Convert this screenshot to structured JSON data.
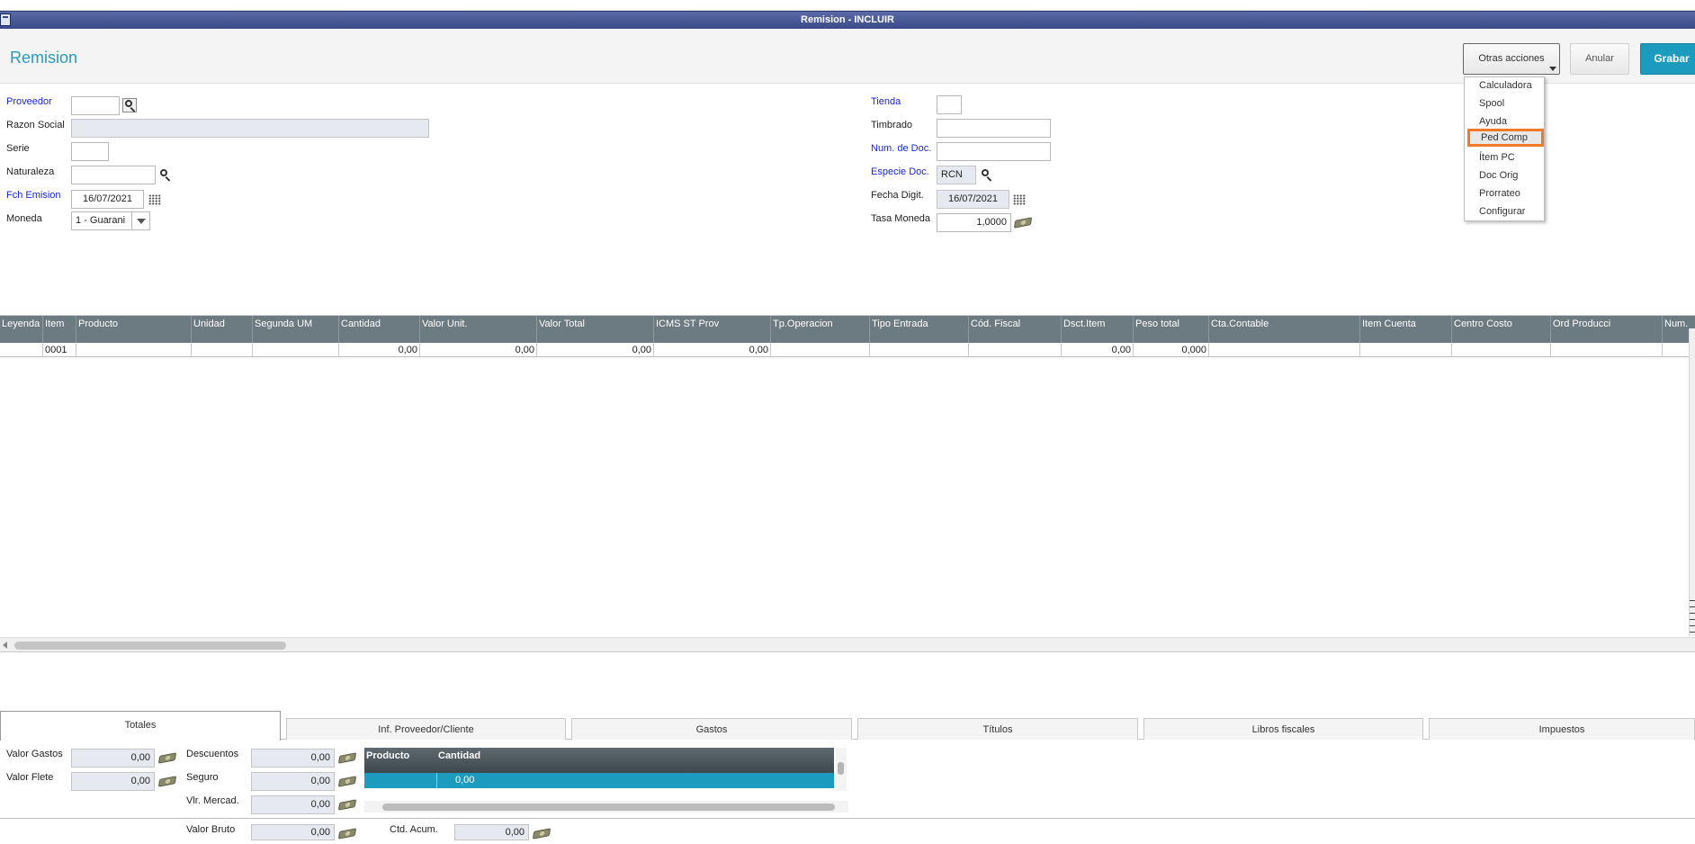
{
  "window": {
    "title": "Remision - INCLUIR"
  },
  "header": {
    "page_title": "Remision",
    "otras_acciones": "Otras acciones",
    "anular": "Anular",
    "grabar": "Grabar"
  },
  "menu": {
    "items": [
      "Calculadora",
      "Spool",
      "Ayuda",
      "Ped Comp",
      "Ítem PC",
      "Doc Orig",
      "Prorrateo",
      "Configurar"
    ],
    "selected": "Ped Comp"
  },
  "form_left": {
    "proveedor_label": "Proveedor",
    "proveedor_value": "",
    "razon_social_label": "Razon Social",
    "razon_social_value": "",
    "serie_label": "Serie",
    "serie_value": "",
    "naturaleza_label": "Naturaleza",
    "naturaleza_value": "",
    "fch_emision_label": "Fch Emision",
    "fch_emision_value": "16/07/2021",
    "moneda_label": "Moneda",
    "moneda_value": "1 - Guarani"
  },
  "form_right": {
    "tienda_label": "Tienda",
    "tienda_value": "",
    "timbrado_label": "Timbrado",
    "timbrado_value": "",
    "num_doc_label": "Num. de Doc.",
    "num_doc_value": "",
    "especie_label": "Especie Doc.",
    "especie_value": "RCN",
    "fecha_digit_label": "Fecha Digit.",
    "fecha_digit_value": "16/07/2021",
    "tasa_label": "Tasa Moneda",
    "tasa_value": "1,0000"
  },
  "grid": {
    "columns": [
      "Leyenda",
      "Item",
      "Producto",
      "Unidad",
      "Segunda UM",
      "Cantidad",
      "Valor Unit.",
      "Valor Total",
      "ICMS ST Prov",
      "Tp.Operacion",
      "Tipo Entrada",
      "Cód. Fiscal",
      "Dsct.Item",
      "Peso total",
      "Cta.Contable",
      "Item Cuenta",
      "Centro Costo",
      "Ord Producci",
      "Num."
    ],
    "rows": [
      [
        "",
        "0001",
        "",
        "",
        "",
        "0,00",
        "0,00",
        "0,00",
        "0,00",
        "",
        "",
        "",
        "0,00",
        "0,000",
        "",
        "",
        "",
        "",
        ""
      ]
    ]
  },
  "tabs": [
    "Totales",
    "Inf. Proveedor/Cliente",
    "Gastos",
    "Títulos",
    "Libros fiscales",
    "Impuestos"
  ],
  "totales": {
    "valor_gastos_label": "Valor Gastos",
    "valor_gastos": "0,00",
    "valor_flete_label": "Valor Flete",
    "valor_flete": "0,00",
    "descuentos_label": "Descuentos",
    "descuentos": "0,00",
    "seguro_label": "Seguro",
    "seguro": "0,00",
    "vlr_mercad_label": "Vlr. Mercad.",
    "vlr_mercad": "0,00",
    "valor_bruto_label": "Valor Bruto",
    "valor_bruto": "0,00",
    "ctd_acum_label": "Ctd. Acum.",
    "ctd_acum": "0,00"
  },
  "mini_grid": {
    "columns": [
      "Producto",
      "Cantidad"
    ],
    "row": [
      "",
      "0,00"
    ]
  },
  "colors": {
    "accent": "#1d9bbf",
    "titlebar": "#3b4a8a",
    "highlight": "#f07a26",
    "grid_header": "#6c7a82"
  }
}
